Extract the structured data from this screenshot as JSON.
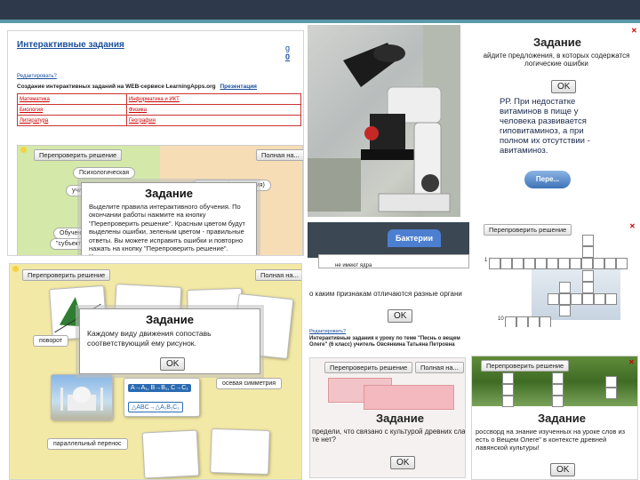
{
  "panel1": {
    "title": "Интерактивные задания",
    "edit_link": "Редактировать?",
    "desc": "Создание интерактивных заданий на WEB-сервисе LearningApps.org",
    "desc_link": "Презентация",
    "letter": "g",
    "digit": "0",
    "table": [
      [
        "Математика",
        "Информатика и ИКТ"
      ],
      [
        "Биология",
        "Физика"
      ],
      [
        "Литература",
        "География"
      ]
    ],
    "recheck": "Перепроверить решение",
    "full": "Полная на...",
    "label1": "Психологическая",
    "label2": "учи",
    "label3": "Обучение",
    "label4": "\"субъект\"",
    "label5": "развитию (интеракция)",
    "dlg_title": "Задание",
    "dlg_text": "Выделите правила интерактивного обучения. По окончании работы нажмите на кнопку \"Перепроверить решение\". Красным цветом будут выделены ошибки, зеленым цветом - правильные ответы. Вы можете исправить ошибки и повторно нажать на кнопку \"Перепроверить решение\". Хотите"
  },
  "panel3": {
    "dlg_title": "Задание",
    "dlg_text": "айдите предложения, в которых содержатся логические ошибки",
    "ok": "OK",
    "body": "РР. При недостатке витаминов в пище у человека развивается гиповитаминоз, а при полном их отсутствии - авитаминоз.",
    "btn": "Пере..."
  },
  "panel4": {
    "tab": "Бактерии",
    "strip": "не имеют ядра",
    "dlg_text": "о каким признакам отличаются разные органи",
    "ok": "OK"
  },
  "panel5": {
    "recheck": "Перепроверить решение",
    "n1": "1",
    "n2": "10"
  },
  "panel6": {
    "recheck": "Перепроверить решение",
    "full": "Полная на...",
    "dlg_title": "Задание",
    "dlg_text": "Каждому виду движения сопоставь соответствующий ему рисунок.",
    "ok": "OK",
    "l1": "поворот",
    "l2": "параллельный перенос",
    "l3": "осевая симметрия",
    "f1": "A→A₁, B→B₁, C→C₁",
    "f2": "△ABC→△A₁B₁C₁"
  },
  "panel7": {
    "edit_link": "Редактировать?",
    "desc": "Интерактивные задания к уроку по теме \"Песнь о вещем Олеге\" (6 класс) учитель Овсянкина Татьяна Петровна",
    "recheck": "Перепроверить решение",
    "full": "Полная на...",
    "dlg_title": "Задание",
    "dlg_text": "предели, что связано с культурой древних сла те нет?",
    "ok": "OK"
  },
  "panel8": {
    "recheck": "Перепроверить решение",
    "dlg_title": "Задание",
    "dlg_text": "россворд на знание изученных на уроке слов из есть о Вещем Олеге\" в контексте древней лавянской культуры!",
    "ok": "OK"
  }
}
